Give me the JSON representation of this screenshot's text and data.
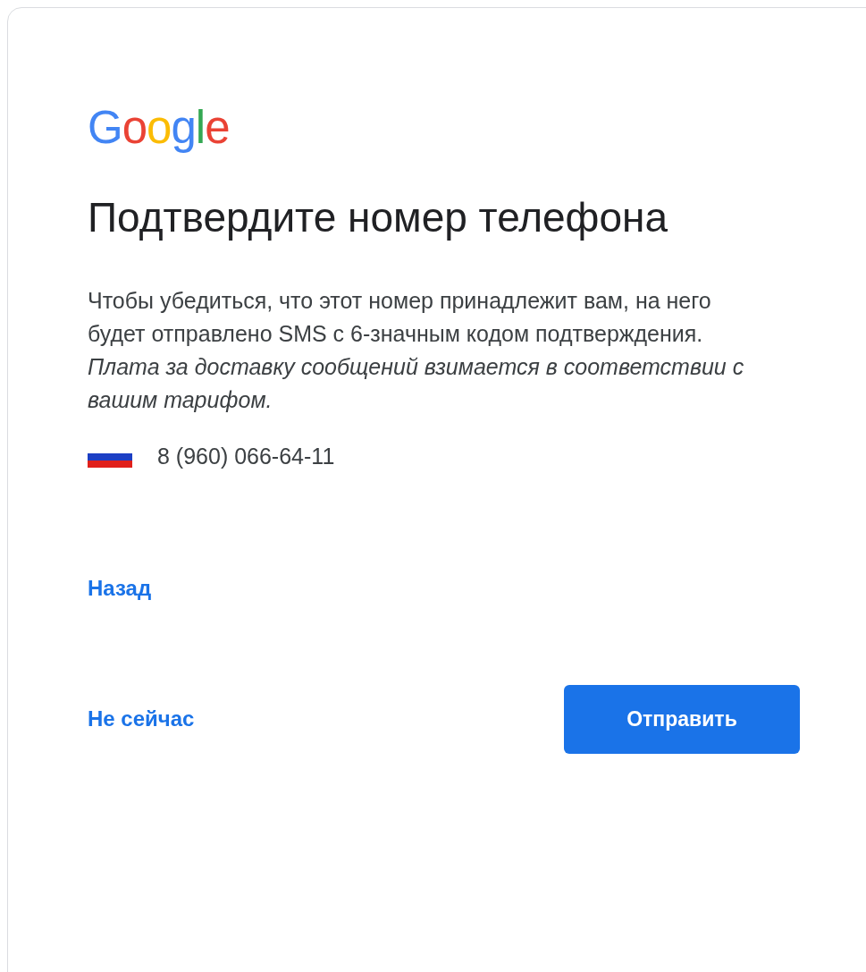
{
  "logo": "Google",
  "title": "Подтвердите номер телефона",
  "description": "Чтобы убедиться, что этот номер принадлежит вам, на него будет отправлено SMS с 6-значным кодом подтверждения. *Плата за доставку сообщений взимается в соответствии с вашим тарифом.*",
  "phone": {
    "number": "8 (960) 066-64-11"
  },
  "back_link": "Назад",
  "skip_link": "Не сейчас",
  "submit_button": "Отправить"
}
